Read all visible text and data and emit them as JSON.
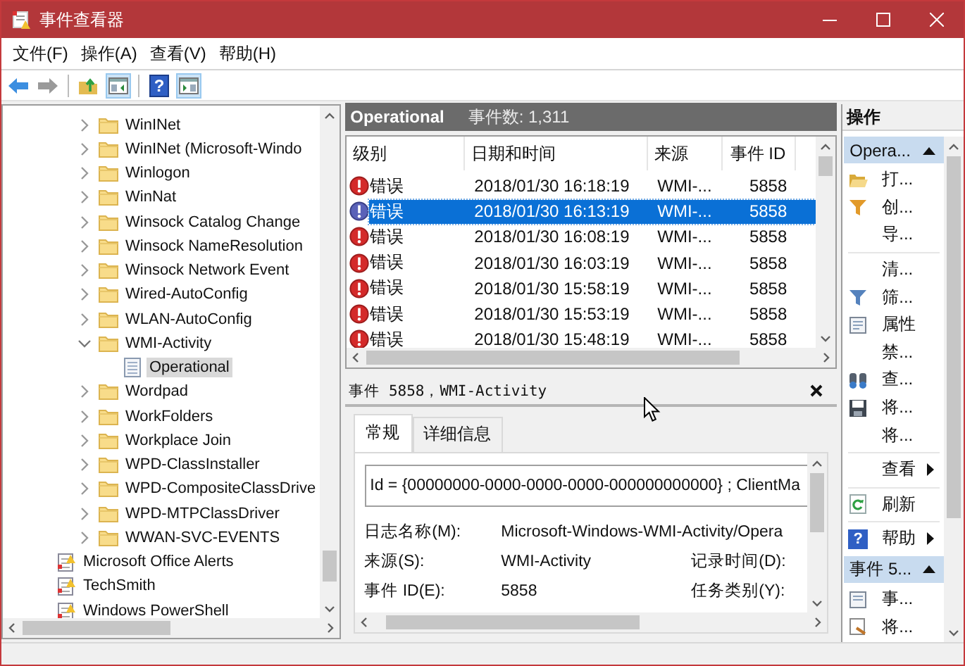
{
  "window": {
    "title": "事件查看器"
  },
  "menu": [
    "文件(F)",
    "操作(A)",
    "查看(V)",
    "帮助(H)"
  ],
  "toolbar": [
    {
      "kind": "back",
      "disabled": false,
      "pressed": false
    },
    {
      "kind": "forward",
      "disabled": true,
      "pressed": false
    },
    {
      "kind": "up",
      "pressed": false
    },
    {
      "kind": "console-tree",
      "pressed": true
    },
    {
      "kind": "help",
      "pressed": false,
      "glyph": "?"
    },
    {
      "kind": "action-pane",
      "pressed": true
    }
  ],
  "tree": {
    "branch": [
      {
        "label": "WinINet",
        "expanded": false,
        "selected": false
      },
      {
        "label": "WinINet (Microsoft-Windo",
        "expanded": false,
        "selected": false
      },
      {
        "label": "Winlogon",
        "expanded": false,
        "selected": false
      },
      {
        "label": "WinNat",
        "expanded": false,
        "selected": false
      },
      {
        "label": "Winsock Catalog Change",
        "expanded": false,
        "selected": false
      },
      {
        "label": "Winsock NameResolution",
        "expanded": false,
        "selected": false
      },
      {
        "label": "Winsock Network Event",
        "expanded": false,
        "selected": false
      },
      {
        "label": "Wired-AutoConfig",
        "expanded": false,
        "selected": false
      },
      {
        "label": "WLAN-AutoConfig",
        "expanded": false,
        "selected": false
      },
      {
        "label": "WMI-Activity",
        "expanded": true,
        "selected": false,
        "children": [
          {
            "label": "Operational",
            "selected": true
          }
        ]
      },
      {
        "label": "Wordpad",
        "expanded": false,
        "selected": false
      },
      {
        "label": "WorkFolders",
        "expanded": false,
        "selected": false
      },
      {
        "label": "Workplace Join",
        "expanded": false,
        "selected": false
      },
      {
        "label": "WPD-ClassInstaller",
        "expanded": false,
        "selected": false
      },
      {
        "label": "WPD-CompositeClassDrive",
        "expanded": false,
        "selected": false
      },
      {
        "label": "WPD-MTPClassDriver",
        "expanded": false,
        "selected": false
      },
      {
        "label": "WWAN-SVC-EVENTS",
        "expanded": false,
        "selected": false
      }
    ],
    "items": [
      {
        "label": "Microsoft Office Alerts",
        "selected": false
      },
      {
        "label": "TechSmith",
        "selected": false
      },
      {
        "label": "Windows PowerShell",
        "selected": false
      }
    ]
  },
  "log_view": {
    "title": "Operational",
    "event_count": "事件数: 1,311",
    "columns": [
      "级别",
      "日期和时间",
      "来源",
      "事件 ID"
    ],
    "rows": [
      {
        "kind": "error",
        "severity": "错误",
        "date": "2018/01/30 16:18:19",
        "source": "WMI-...",
        "event_id": "5858",
        "selected": false
      },
      {
        "kind": "error",
        "severity": "错误",
        "date": "2018/01/30 16:13:19",
        "source": "WMI-...",
        "event_id": "5858",
        "selected": true
      },
      {
        "kind": "error",
        "severity": "错误",
        "date": "2018/01/30 16:08:19",
        "source": "WMI-...",
        "event_id": "5858",
        "selected": false
      },
      {
        "kind": "error",
        "severity": "错误",
        "date": "2018/01/30 16:03:19",
        "source": "WMI-...",
        "event_id": "5858",
        "selected": false
      },
      {
        "kind": "error",
        "severity": "错误",
        "date": "2018/01/30 15:58:19",
        "source": "WMI-...",
        "event_id": "5858",
        "selected": false
      },
      {
        "kind": "error",
        "severity": "错误",
        "date": "2018/01/30 15:53:19",
        "source": "WMI-...",
        "event_id": "5858",
        "selected": false
      },
      {
        "kind": "error",
        "severity": "错误",
        "date": "2018/01/30 15:48:19",
        "source": "WMI-...",
        "event_id": "5858",
        "selected": false
      }
    ]
  },
  "event_detail": {
    "title": "事件 5858，WMI-Activity",
    "tabs": [
      {
        "label": "常规",
        "selected": true
      },
      {
        "label": "详细信息",
        "selected": false
      }
    ],
    "description": "Id = {00000000-0000-0000-0000-000000000000} ; ClientMa",
    "fields": [
      {
        "label": "日志名称(M):",
        "value": "Microsoft-Windows-WMI-Activity/Opera"
      },
      {
        "label": "来源(S):",
        "value": "WMI-Activity",
        "label_2": "记录时间(D):"
      },
      {
        "label": "事件 ID(E):",
        "value": "5858",
        "label_2": "任务类别(Y):"
      }
    ]
  },
  "actions": {
    "title": "操作",
    "sections": [
      {
        "title": "Opera...",
        "expanded": true,
        "groups": [
          {
            "items": [
              {
                "kind": "command",
                "label": "打..."
              },
              {
                "kind": "command",
                "label": "创..."
              },
              {
                "kind": "command",
                "label": "导..."
              }
            ]
          },
          {
            "items": [
              {
                "kind": "command",
                "label": "清..."
              },
              {
                "kind": "command",
                "label": "筛..."
              },
              {
                "kind": "command",
                "label": "属性"
              },
              {
                "kind": "command",
                "label": "禁..."
              },
              {
                "kind": "command",
                "label": "查..."
              },
              {
                "kind": "command",
                "label": "将..."
              },
              {
                "kind": "command",
                "label": "将..."
              }
            ]
          },
          {
            "items": [
              {
                "kind": "submenu",
                "label": "查看"
              }
            ]
          },
          {
            "items": [
              {
                "kind": "command",
                "label": "刷新"
              }
            ]
          },
          {
            "items": [
              {
                "kind": "submenu",
                "label": "帮助",
                "glyph": "?"
              }
            ]
          }
        ]
      },
      {
        "title": "事件 5...",
        "expanded": true,
        "groups": [
          {
            "items": [
              {
                "kind": "command",
                "label": "事..."
              },
              {
                "kind": "command",
                "label": "将..."
              }
            ]
          }
        ]
      }
    ]
  }
}
